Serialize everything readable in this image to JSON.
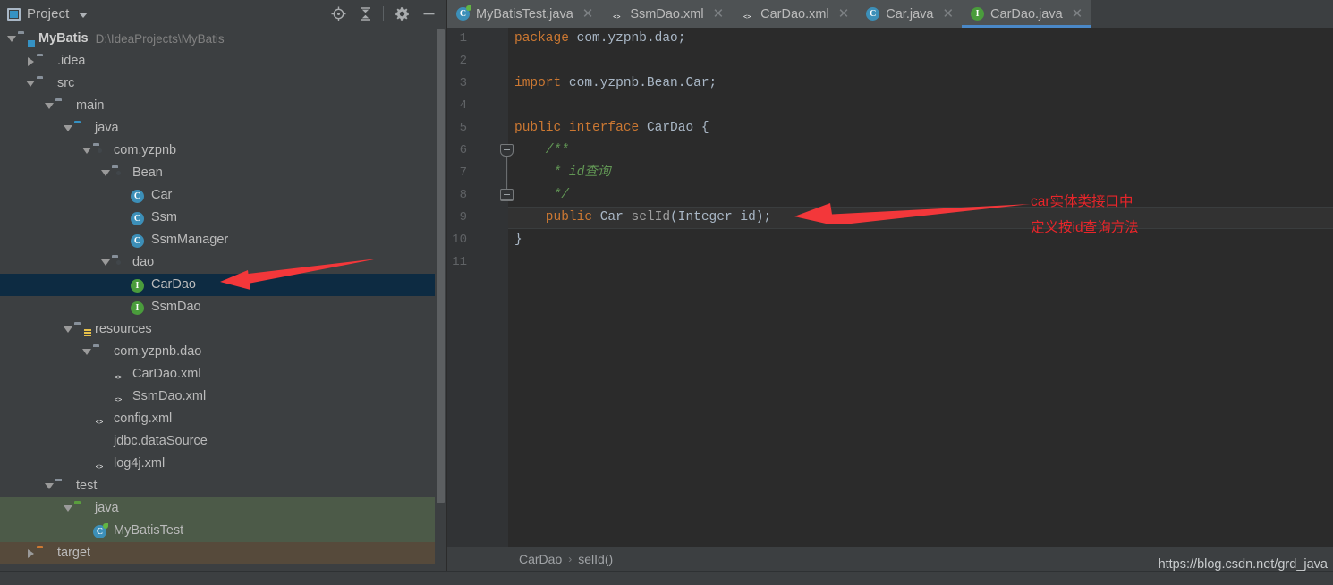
{
  "project_panel": {
    "title": "Project",
    "icons": {
      "locate": "locate-icon",
      "collapse_all": "collapse-all-icon",
      "settings": "gear-icon",
      "hide": "minimize-icon"
    },
    "tree": [
      {
        "depth": 0,
        "arrow": "down",
        "icon": "module-folder",
        "label": "MyBatis",
        "bold": true,
        "path": "D:\\IdeaProjects\\MyBatis"
      },
      {
        "depth": 1,
        "arrow": "right",
        "icon": "folder",
        "label": ".idea"
      },
      {
        "depth": 1,
        "arrow": "down",
        "icon": "folder",
        "label": "src"
      },
      {
        "depth": 2,
        "arrow": "down",
        "icon": "folder",
        "label": "main"
      },
      {
        "depth": 3,
        "arrow": "down",
        "icon": "folder-blue",
        "label": "java"
      },
      {
        "depth": 4,
        "arrow": "down",
        "icon": "package",
        "label": "com.yzpnb"
      },
      {
        "depth": 5,
        "arrow": "down",
        "icon": "package",
        "label": "Bean"
      },
      {
        "depth": 6,
        "arrow": "none",
        "icon": "class",
        "label": "Car"
      },
      {
        "depth": 6,
        "arrow": "none",
        "icon": "class",
        "label": "Ssm"
      },
      {
        "depth": 6,
        "arrow": "none",
        "icon": "class",
        "label": "SsmManager"
      },
      {
        "depth": 5,
        "arrow": "down",
        "icon": "package",
        "label": "dao"
      },
      {
        "depth": 6,
        "arrow": "none",
        "icon": "interface",
        "label": "CarDao",
        "selected": true
      },
      {
        "depth": 6,
        "arrow": "none",
        "icon": "interface",
        "label": "SsmDao"
      },
      {
        "depth": 3,
        "arrow": "down",
        "icon": "resources",
        "label": "resources"
      },
      {
        "depth": 4,
        "arrow": "down",
        "icon": "folder",
        "label": "com.yzpnb.dao"
      },
      {
        "depth": 5,
        "arrow": "none",
        "icon": "xml",
        "label": "CarDao.xml"
      },
      {
        "depth": 5,
        "arrow": "none",
        "icon": "xml",
        "label": "SsmDao.xml"
      },
      {
        "depth": 4,
        "arrow": "none",
        "icon": "xml",
        "label": "config.xml"
      },
      {
        "depth": 4,
        "arrow": "none",
        "icon": "file",
        "label": "jdbc.dataSource"
      },
      {
        "depth": 4,
        "arrow": "none",
        "icon": "xml",
        "label": "log4j.xml"
      },
      {
        "depth": 2,
        "arrow": "down",
        "icon": "folder",
        "label": "test"
      },
      {
        "depth": 3,
        "arrow": "down",
        "icon": "folder-green",
        "label": "java",
        "band": "green"
      },
      {
        "depth": 4,
        "arrow": "none",
        "icon": "test-class",
        "label": "MyBatisTest",
        "band": "green"
      },
      {
        "depth": 1,
        "arrow": "right",
        "icon": "folder-orange",
        "label": "target",
        "band": "brown"
      }
    ]
  },
  "editor": {
    "tabs": [
      {
        "label": "MyBatisTest.java",
        "icon": "test-class-icon",
        "active": false
      },
      {
        "label": "SsmDao.xml",
        "icon": "xml-file-icon",
        "active": false
      },
      {
        "label": "CarDao.xml",
        "icon": "xml-file-icon",
        "active": false
      },
      {
        "label": "Car.java",
        "icon": "class-icon",
        "active": false
      },
      {
        "label": "CarDao.java",
        "icon": "interface-icon",
        "active": true
      }
    ],
    "line_numbers": [
      "1",
      "2",
      "3",
      "4",
      "5",
      "6",
      "7",
      "8",
      "9",
      "10",
      "11"
    ],
    "code_lines": [
      {
        "num": 1,
        "tokens": [
          {
            "t": "package ",
            "c": "kw"
          },
          {
            "t": "com.yzpnb.dao;",
            "c": "plain"
          }
        ]
      },
      {
        "num": 2,
        "tokens": []
      },
      {
        "num": 3,
        "tokens": [
          {
            "t": "import ",
            "c": "kw"
          },
          {
            "t": "com.yzpnb.Bean.Car;",
            "c": "plain"
          }
        ]
      },
      {
        "num": 4,
        "tokens": []
      },
      {
        "num": 5,
        "tokens": [
          {
            "t": "public ",
            "c": "kw"
          },
          {
            "t": "interface ",
            "c": "kw"
          },
          {
            "t": "CarDao ",
            "c": "plain"
          },
          {
            "t": "{",
            "c": "plain"
          }
        ]
      },
      {
        "num": 6,
        "tokens": [
          {
            "t": "    /**",
            "c": "cmt"
          }
        ]
      },
      {
        "num": 7,
        "tokens": [
          {
            "t": "     * id查询",
            "c": "cmt"
          }
        ]
      },
      {
        "num": 8,
        "tokens": [
          {
            "t": "     */",
            "c": "cmt"
          }
        ]
      },
      {
        "num": 9,
        "tokens": [
          {
            "t": "    public ",
            "c": "kw"
          },
          {
            "t": "Car ",
            "c": "plain"
          },
          {
            "t": "selId",
            "c": "mth"
          },
          {
            "t": "(",
            "c": "plain"
          },
          {
            "t": "Integer id",
            "c": "plain"
          },
          {
            "t": ");",
            "c": "plain"
          }
        ],
        "caret": true
      },
      {
        "num": 10,
        "tokens": [
          {
            "t": "}",
            "c": "plain"
          }
        ]
      },
      {
        "num": 11,
        "tokens": []
      }
    ],
    "caret_line_number": 9
  },
  "annotation": {
    "text": "car实体类接口中\n定义按id查询方法",
    "color": "#e8252a"
  },
  "status": {
    "breadcrumb": [
      "CarDao",
      "selId()"
    ],
    "breadcrumb_separator": "›",
    "watermark": "https://blog.csdn.net/grd_java"
  },
  "colors": {
    "panel_bg": "#3c3f41",
    "editor_bg": "#2b2b2b",
    "gutter_bg": "#313335",
    "selection": "#0d2b42",
    "test_band": "#4c5a48",
    "target_band": "#564a3b",
    "accent": "#4a88c7",
    "annotation_red": "#e8252a"
  }
}
